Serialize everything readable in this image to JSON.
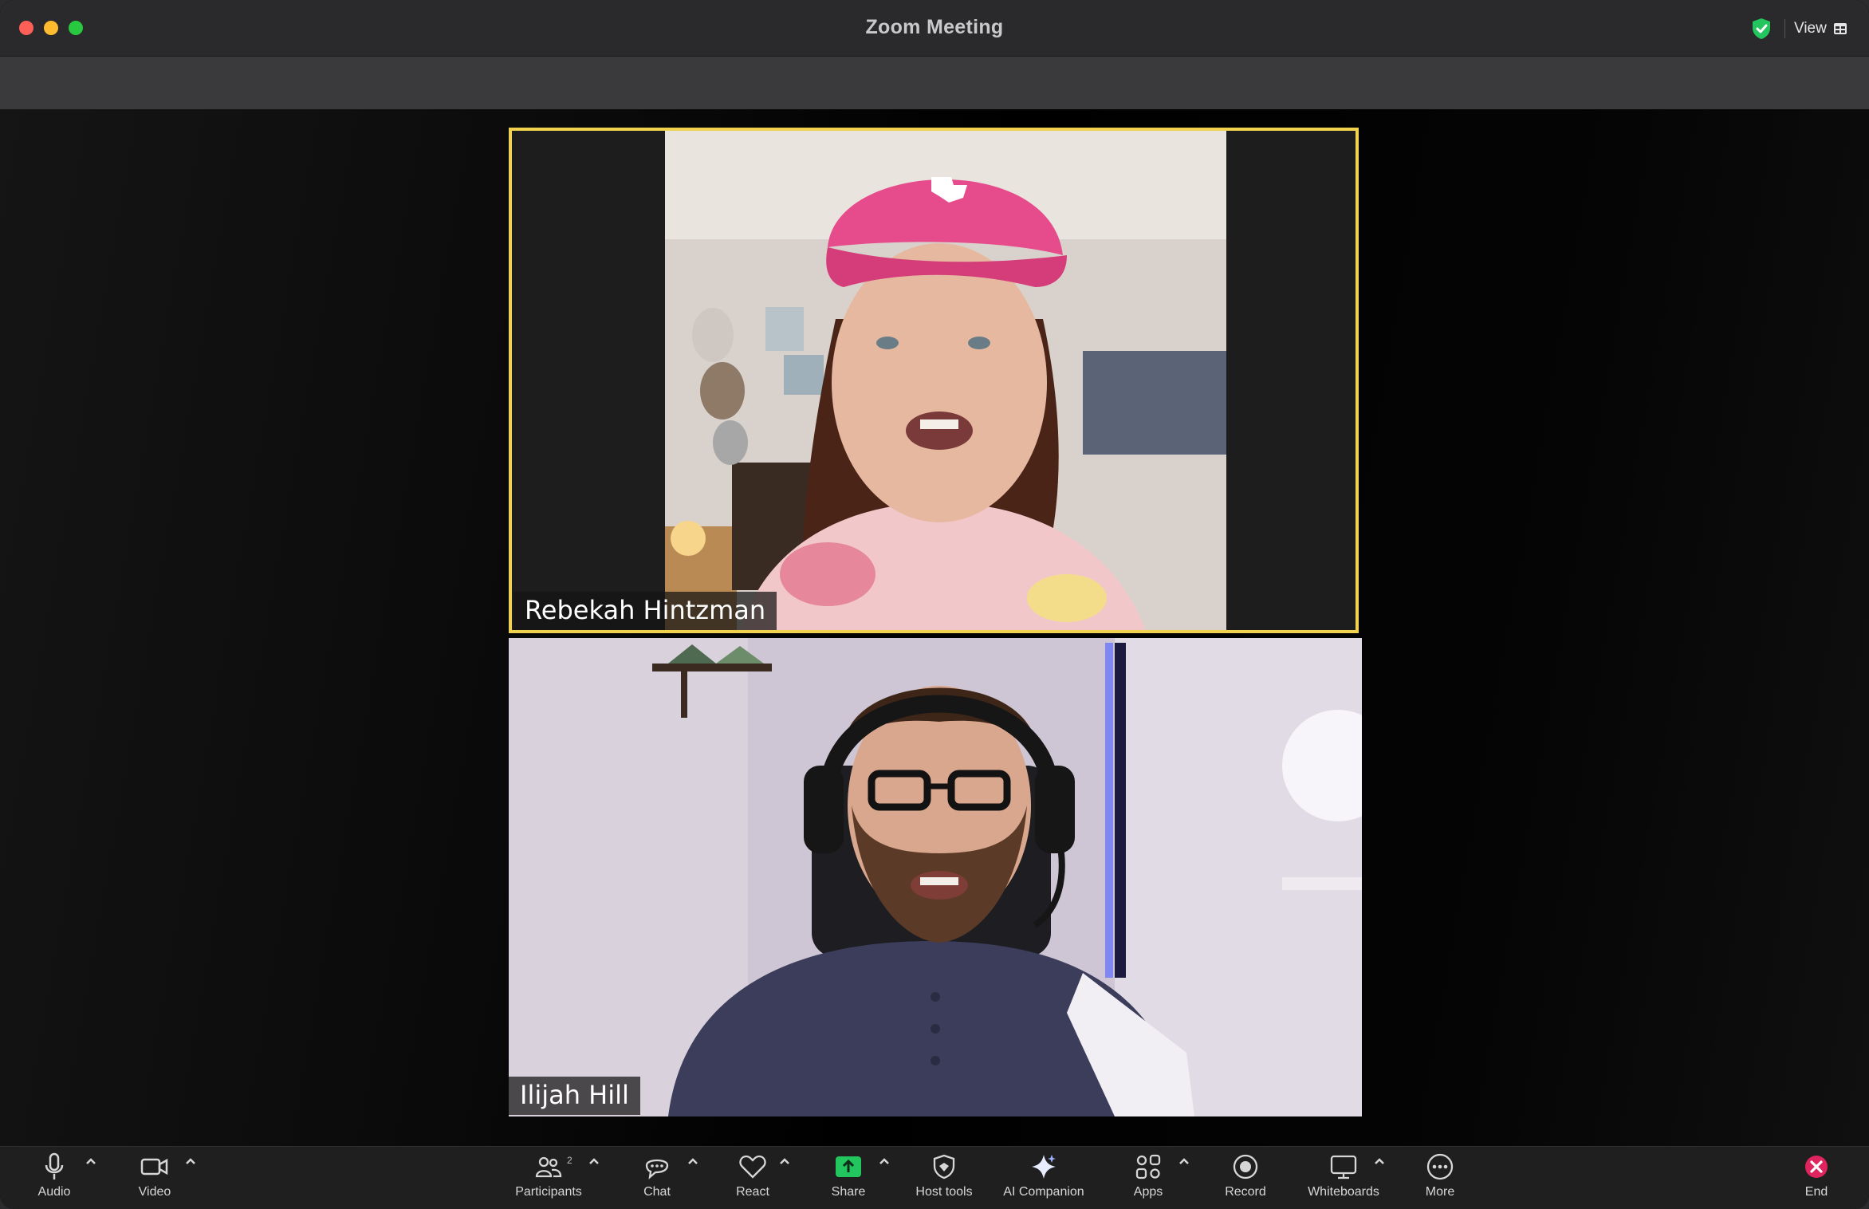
{
  "window": {
    "title": "Zoom Meeting",
    "view_label": "View"
  },
  "colors": {
    "active_speaker_border": "#f0d24e",
    "shield_green": "#23c55e",
    "share_green": "#23c55e",
    "end_red": "#e0245e"
  },
  "participants": [
    {
      "name": "Rebekah Hintzman",
      "active_speaker": true
    },
    {
      "name": "Ilijah Hill",
      "active_speaker": false
    }
  ],
  "toolbar": {
    "audio": "Audio",
    "video": "Video",
    "participants": "Participants",
    "participants_count": "2",
    "chat": "Chat",
    "react": "React",
    "share": "Share",
    "host_tools": "Host tools",
    "ai_companion": "AI Companion",
    "apps": "Apps",
    "record": "Record",
    "whiteboards": "Whiteboards",
    "more": "More",
    "end": "End"
  },
  "icons": {
    "audio": "microphone-icon",
    "video": "video-camera-icon",
    "participants": "people-icon",
    "chat": "chat-bubble-icon",
    "react": "heart-icon",
    "share": "share-screen-icon",
    "host_tools": "shield-icon",
    "ai_companion": "sparkle-icon",
    "apps": "apps-grid-icon",
    "record": "record-icon",
    "whiteboards": "whiteboard-icon",
    "more": "ellipsis-icon",
    "end": "close-icon"
  }
}
